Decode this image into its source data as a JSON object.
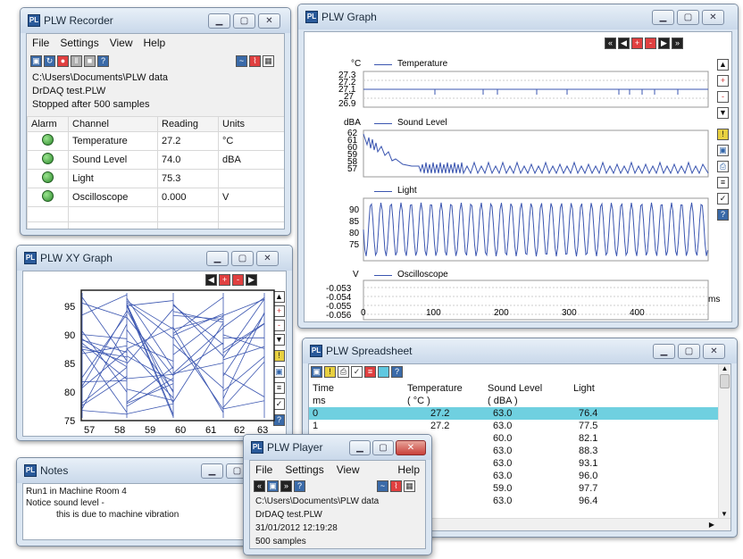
{
  "recorder": {
    "title": "PLW Recorder",
    "menu": [
      "File",
      "Settings",
      "View",
      "Help"
    ],
    "path": "C:\\Users\\Documents\\PLW data",
    "file": "DrDAQ test.PLW",
    "status": "Stopped after 500 samples",
    "headers": [
      "Alarm",
      "Channel",
      "Reading",
      "Units"
    ],
    "rows": [
      {
        "channel": "Temperature",
        "reading": "27.2",
        "units": "°C"
      },
      {
        "channel": "Sound Level",
        "reading": "74.0",
        "units": "dBA"
      },
      {
        "channel": "Light",
        "reading": "75.3",
        "units": ""
      },
      {
        "channel": "Oscilloscope",
        "reading": "0.000",
        "units": "V"
      }
    ]
  },
  "graph": {
    "title": "PLW Graph",
    "panels": [
      {
        "unit": "°C",
        "name": "Temperature",
        "ticks": [
          "27.3",
          "27.2",
          "27.1",
          "27",
          "26.9"
        ]
      },
      {
        "unit": "dBA",
        "name": "Sound Level",
        "ticks": [
          "62",
          "61",
          "60",
          "59",
          "58",
          "57"
        ]
      },
      {
        "unit": "",
        "name": "Light",
        "ticks": [
          "90",
          "85",
          "80",
          "75"
        ]
      },
      {
        "unit": "V",
        "name": "Oscilloscope",
        "ticks": [
          "-0.053",
          "-0.054",
          "-0.055",
          "-0.056"
        ]
      }
    ],
    "xticks": [
      "0",
      "100",
      "200",
      "300",
      "400"
    ],
    "xunit": "ms"
  },
  "xy": {
    "title": "PLW XY Graph",
    "yticks": [
      "95",
      "90",
      "85",
      "80",
      "75"
    ],
    "xticks": [
      "57",
      "58",
      "59",
      "60",
      "61",
      "62",
      "63"
    ]
  },
  "spreadsheet": {
    "title": "PLW Spreadsheet",
    "headers": [
      "Time",
      "Temperature",
      "Sound Level",
      "Light"
    ],
    "units": [
      "ms",
      "( °C )",
      "( dBA )",
      ""
    ],
    "rows": [
      [
        "0",
        "27.2",
        "63.0",
        "76.4"
      ],
      [
        "1",
        "27.2",
        "63.0",
        "77.5"
      ],
      [
        "",
        "",
        "60.0",
        "82.1"
      ],
      [
        "",
        "",
        "63.0",
        "88.3"
      ],
      [
        "",
        "",
        "63.0",
        "93.1"
      ],
      [
        "",
        "",
        "63.0",
        "96.0"
      ],
      [
        "",
        "",
        "59.0",
        "97.7"
      ],
      [
        "",
        "",
        "63.0",
        "96.4"
      ]
    ]
  },
  "notes": {
    "title": "Notes",
    "line1": "Run1 in Machine Room 4",
    "line2": "Notice sound level -",
    "line3": "this is due to machine vibration"
  },
  "player": {
    "title": "PLW Player",
    "menu": [
      "File",
      "Settings",
      "View",
      "Help"
    ],
    "path": "C:\\Users\\Documents\\PLW data",
    "file": "DrDAQ test.PLW",
    "datetime": "31/01/2012 12:19:28",
    "samples": "500 samples"
  },
  "colors": {
    "plot": "#3a55b0",
    "select": "#6fd0e0"
  }
}
